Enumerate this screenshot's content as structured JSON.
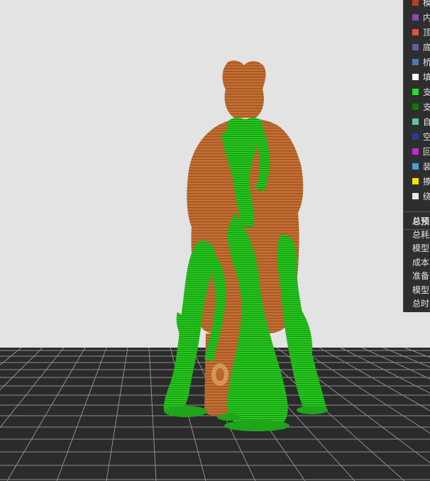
{
  "legend": {
    "items": [
      {
        "label": "模",
        "color": "#c0392b"
      },
      {
        "label": "内",
        "color": "#8e44ad"
      },
      {
        "label": "顶",
        "color": "#e74c3c"
      },
      {
        "label": "底",
        "color": "#5b5fb5"
      },
      {
        "label": "桥",
        "color": "#4a78b5"
      },
      {
        "label": "填",
        "color": "#ffffff"
      },
      {
        "label": "支",
        "color": "#22e022"
      },
      {
        "label": "支",
        "color": "#0b7a0b"
      },
      {
        "label": "自",
        "color": "#5cc9a0"
      },
      {
        "label": "空",
        "color": "#2a3a9c"
      },
      {
        "label": "回",
        "color": "#c02ad6"
      },
      {
        "label": "装",
        "color": "#3fa3d6"
      },
      {
        "label": "擦",
        "color": "#f5e100"
      },
      {
        "label": "绕",
        "color": "#e8e8e8"
      }
    ]
  },
  "summary": {
    "title": "总预",
    "rows": [
      "总耗",
      "模型",
      "成本",
      "准备",
      "模型",
      "总时"
    ]
  },
  "colors": {
    "background": "#e3e3e3",
    "bed": "#2b2b2b",
    "bed_grid": "#9a9a9a",
    "model": "#c77538",
    "support": "#22c41c"
  }
}
